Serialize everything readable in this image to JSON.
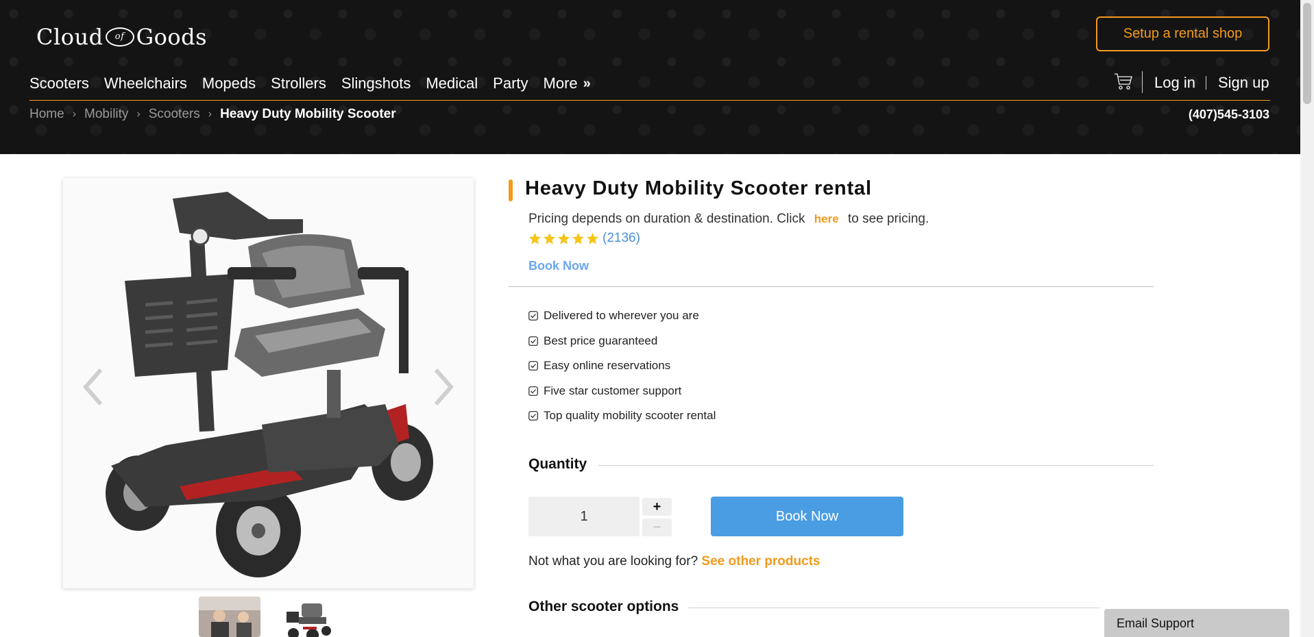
{
  "header": {
    "logo": {
      "left": "Cloud",
      "of": "of",
      "right": "Goods"
    },
    "setup_button": "Setup a rental shop",
    "nav": [
      "Scooters",
      "Wheelchairs",
      "Mopeds",
      "Strollers",
      "Slingshots",
      "Medical",
      "Party"
    ],
    "more_label": "More",
    "more_chevron": "»",
    "login": "Log in",
    "signup": "Sign up",
    "breadcrumbs": [
      "Home",
      "Mobility",
      "Scooters"
    ],
    "breadcrumb_current": "Heavy Duty Mobility Scooter",
    "breadcrumb_separator": "›",
    "phone": "(407)545-3103",
    "accent_color": "#f39a1b",
    "background_color": "#141414"
  },
  "product": {
    "title": "Heavy Duty Mobility Scooter rental",
    "pricing_before": "Pricing depends on duration & destination. Click",
    "pricing_link": "here",
    "pricing_after": "to see pricing.",
    "rating_stars": 5,
    "rating_count": "(2136)",
    "book_now_link": "Book Now",
    "features": [
      "Delivered to wherever you are",
      "Best price guaranteed",
      "Easy online reservations",
      "Five star customer support",
      "Top quality mobility scooter rental"
    ],
    "quantity_title": "Quantity",
    "quantity_value": "1",
    "plus": "+",
    "minus": "−",
    "book_button": "Book Now",
    "not_what": "Not what you are looking for?",
    "see_other": "See other products",
    "other_options_title": "Other scooter options",
    "book_button_color": "#4a9de3",
    "star_color": "#f5c518"
  },
  "gallery": {
    "prev_icon": "chevron-left-icon",
    "next_icon": "chevron-right-icon",
    "thumbnail_count": 2
  },
  "support": {
    "email_support": "Email Support"
  }
}
